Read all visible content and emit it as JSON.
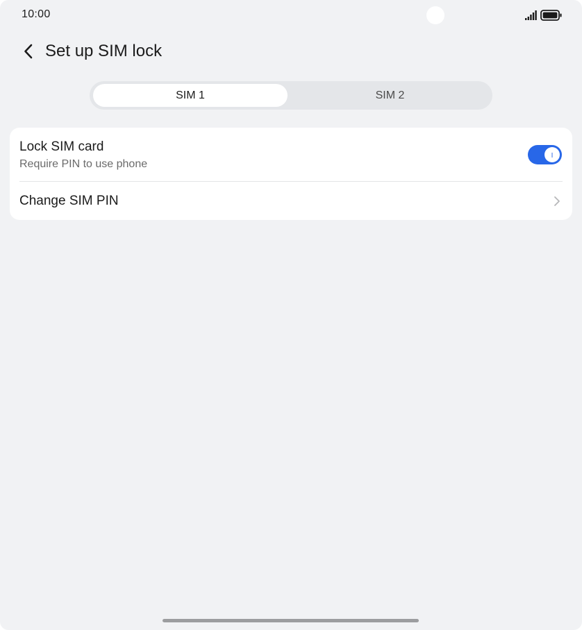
{
  "status_bar": {
    "time": "10:00",
    "signal_icon": "signal-bars-icon",
    "battery_icon": "battery-full-icon"
  },
  "header": {
    "back_icon": "chevron-left-icon",
    "title": "Set up SIM lock"
  },
  "tabs": [
    {
      "label": "SIM 1",
      "selected": true
    },
    {
      "label": "SIM 2",
      "selected": false
    }
  ],
  "settings": {
    "lock_sim": {
      "title": "Lock SIM card",
      "subtitle": "Require PIN to use phone",
      "enabled": true
    },
    "change_pin": {
      "title": "Change SIM PIN",
      "icon": "chevron-right-icon"
    }
  },
  "colors": {
    "background": "#f1f2f4",
    "card": "#ffffff",
    "accent": "#2867e8",
    "text_primary": "#1b1b1b",
    "text_secondary": "#6a6a6a"
  }
}
